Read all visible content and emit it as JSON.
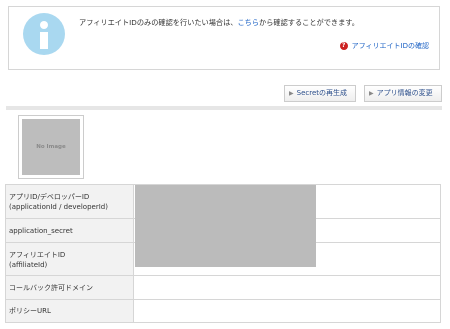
{
  "notice": {
    "text_before": "アフィリエイトIDのみの確認を行いたい場合は、",
    "link_text": "こちら",
    "text_after": "から確認することができます。",
    "help_link": "アフィリエイトIDの確認"
  },
  "buttons": {
    "secret_regen": "Secretの再生成",
    "app_info_change": "アプリ情報の変更"
  },
  "image": {
    "placeholder": "No Image"
  },
  "table": {
    "rows": [
      {
        "label_line1": "アプリID/デベロッパーID",
        "label_line2": "(applicationId / developerId)",
        "value": ""
      },
      {
        "label_line1": "application_secret",
        "label_line2": "",
        "value": ""
      },
      {
        "label_line1": "アフィリエイトID",
        "label_line2": "(affiliateId)",
        "value": ""
      },
      {
        "label_line1": "コールバック許可ドメイン",
        "label_line2": "",
        "value": ""
      },
      {
        "label_line1": "ポリシーURL",
        "label_line2": "",
        "value": ""
      }
    ]
  },
  "colors": {
    "info_icon": "#a9d8f0",
    "link": "#1a60c4",
    "help_icon": "#cc2222",
    "masked_block": "#bbbbbb"
  }
}
